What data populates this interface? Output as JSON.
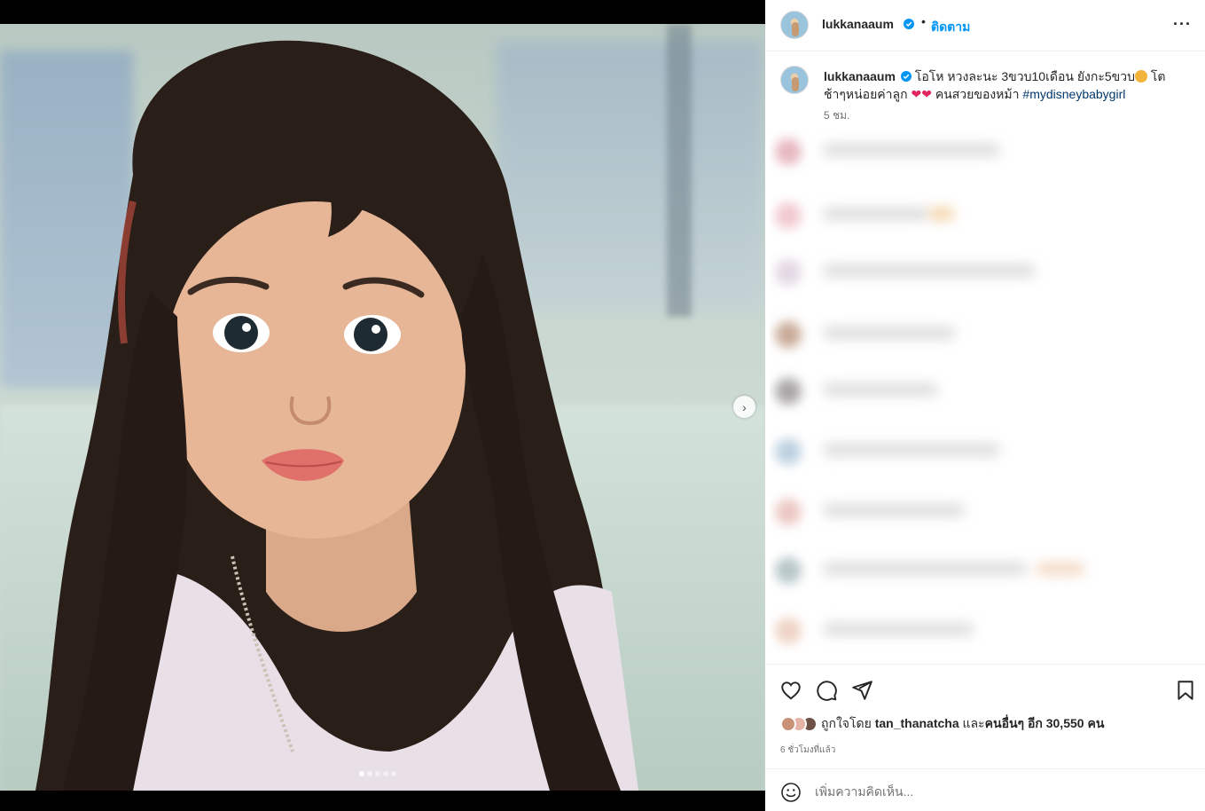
{
  "post": {
    "username": "lukkanaaum",
    "separator": "•",
    "follow_label": "ติดตาม",
    "more_icon": "more-horizontal-icon",
    "caption": {
      "text_part1": "โอโห หวงละนะ 3ขวบ10เดือน ยังกะ5ขวบ",
      "text_part2": " โตช้าๆหน่อยค่าลูก ",
      "text_part3": " คนสวยของหม้า ",
      "hashtag": "#mydisneybabygirl",
      "time": "5 ชม."
    },
    "likes": {
      "prefix": "ถูกใจโดย",
      "liked_by": "tan_thanatcha",
      "and": "และ",
      "others": "คนอื่นๆ อีก 30,550 คน"
    },
    "posted_ago": "6 ชั่วโมงที่แล้ว",
    "comment_placeholder": "เพิ่มความคิดเห็น...",
    "carousel": {
      "total_slides": 5,
      "current_slide": 1
    }
  },
  "colors": {
    "accent": "#0095f6",
    "hashtag": "#00376b",
    "verified": "#0095f6",
    "heart": "#e0245e",
    "muted": "#737373"
  }
}
